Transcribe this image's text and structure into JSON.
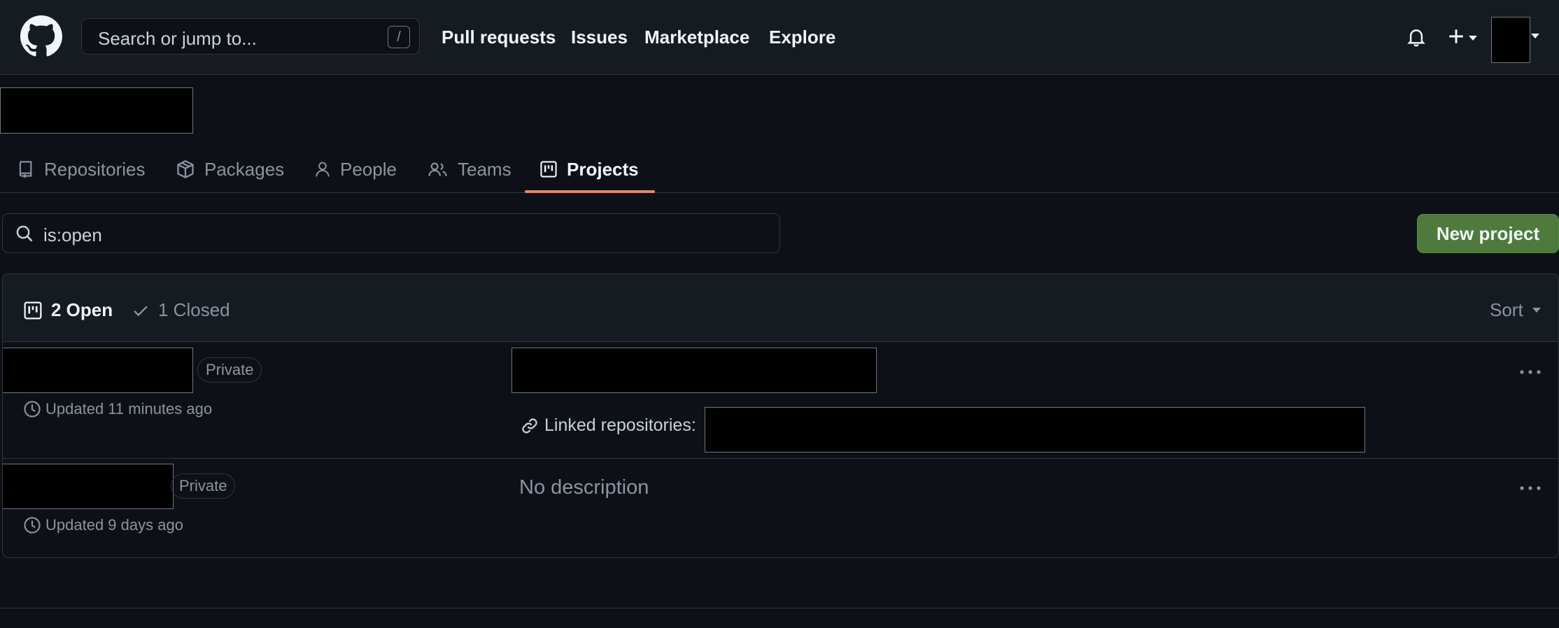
{
  "header": {
    "search_placeholder": "Search or jump to...",
    "search_shortcut": "/",
    "nav": [
      "Pull requests",
      "Issues",
      "Marketplace",
      "Explore"
    ],
    "icons": [
      "github-logo-icon",
      "bell-icon",
      "plus-icon",
      "avatar"
    ]
  },
  "tabs": [
    {
      "label": "Repositories",
      "icon": "repo-icon"
    },
    {
      "label": "Packages",
      "icon": "package-icon"
    },
    {
      "label": "People",
      "icon": "person-icon"
    },
    {
      "label": "Teams",
      "icon": "people-icon"
    },
    {
      "label": "Projects",
      "icon": "project-icon",
      "active": true
    }
  ],
  "filter": {
    "value": "is:open"
  },
  "actions": {
    "new_project": "New project"
  },
  "projects_header": {
    "open": "2 Open",
    "closed": "1 Closed",
    "sort": "Sort"
  },
  "projects": [
    {
      "visibility": "Private",
      "updated": "Updated 11 minutes ago",
      "linked_label": "Linked repositories:"
    },
    {
      "visibility": "Private",
      "updated": "Updated 9 days ago",
      "description": "No description"
    }
  ],
  "colors": {
    "background": "#0d1117",
    "header": "#161b22",
    "border": "#30363d",
    "accent_tab": "#f78166",
    "primary_button": "#4e7b3c"
  }
}
